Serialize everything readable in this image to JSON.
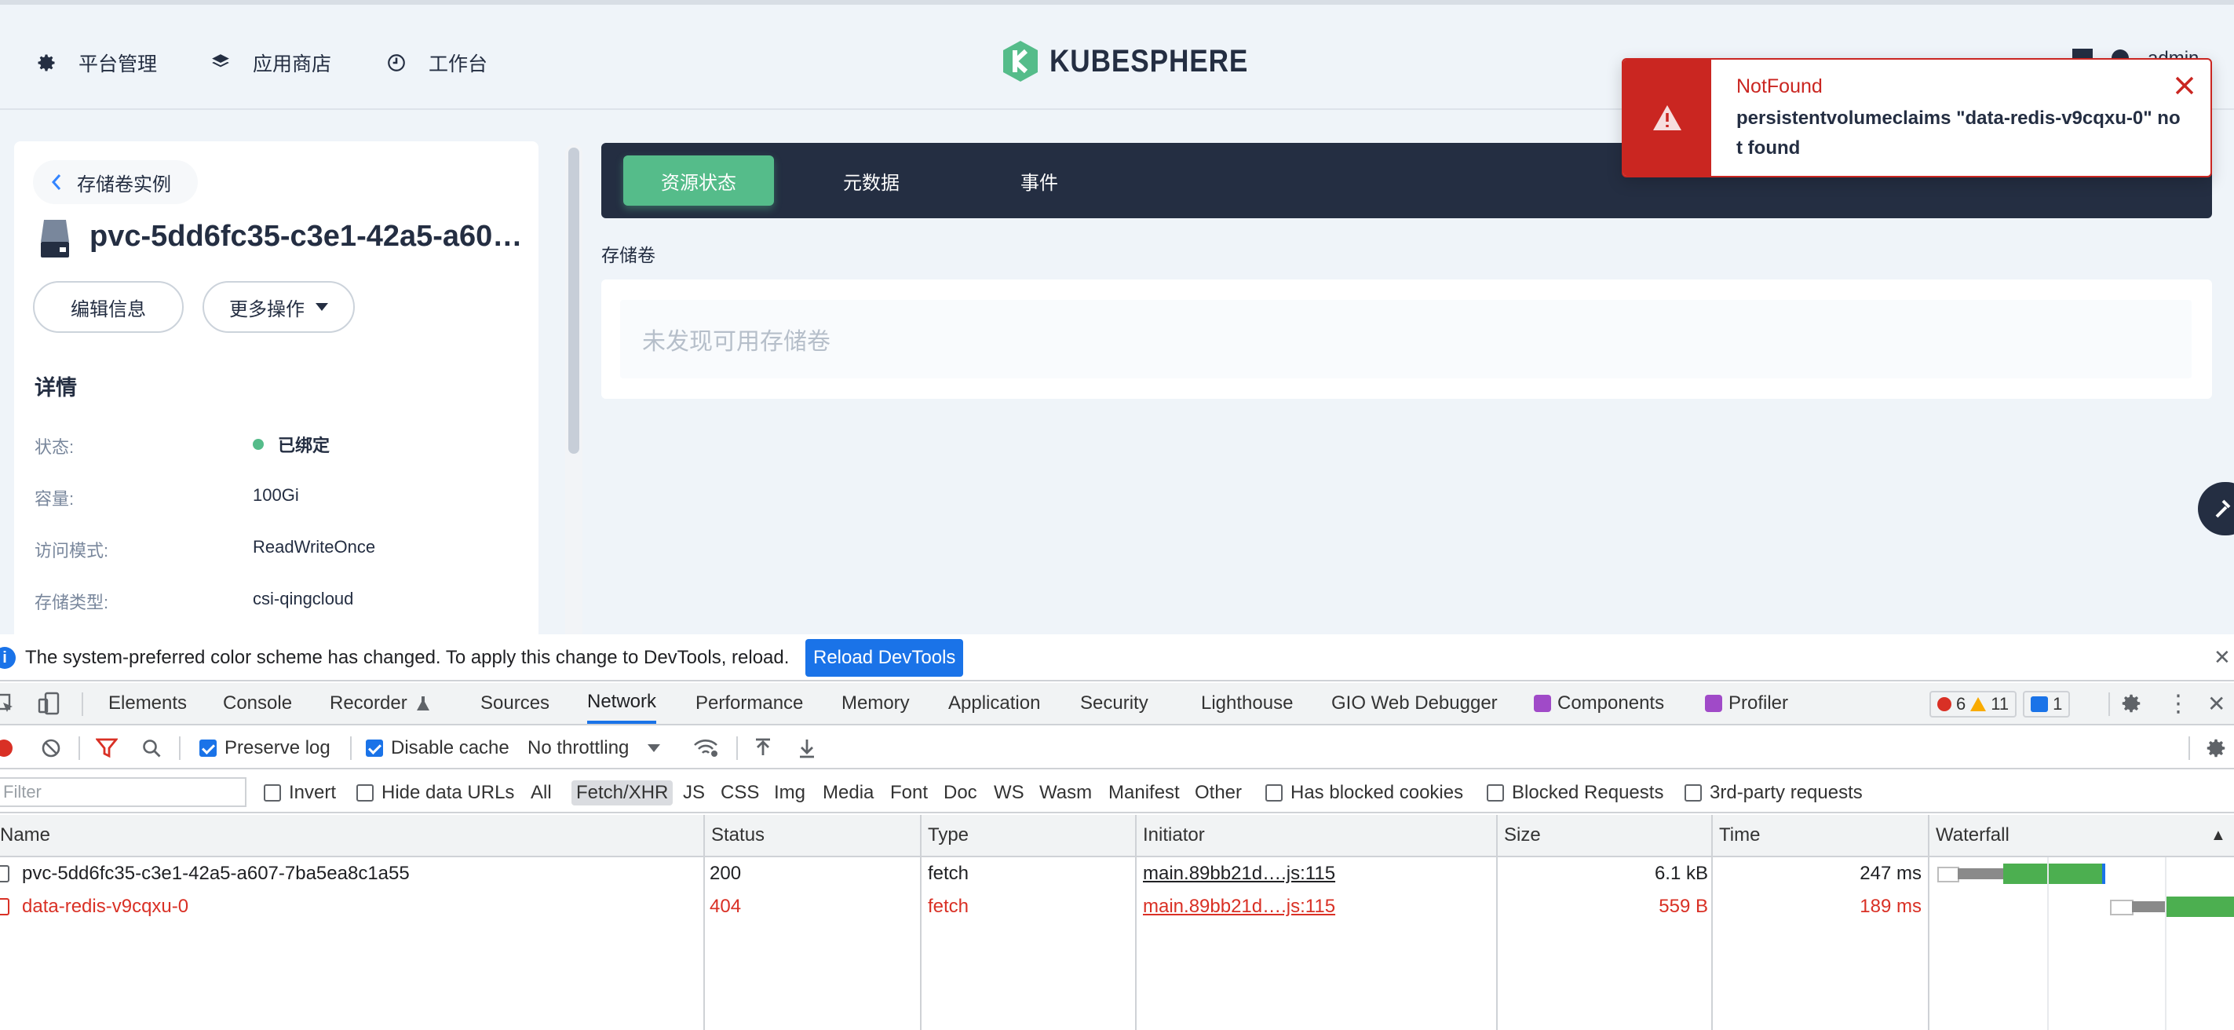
{
  "topbar": {
    "nav": [
      {
        "label": "平台管理",
        "icon": "gear-icon"
      },
      {
        "label": "应用商店",
        "icon": "layers-icon"
      },
      {
        "label": "工作台",
        "icon": "clock-icon"
      }
    ],
    "logo_text": "KUBESPHERE",
    "user_name": "admin"
  },
  "toast": {
    "title": "NotFound",
    "message": "persistentvolumeclaims \"data-redis-v9cqxu-0\" not found"
  },
  "detail": {
    "back_label": "存储卷实例",
    "title": "pvc-5dd6fc35-c3e1-42a5-a607-7ba5ea8c1a55",
    "edit_label": "编辑信息",
    "more_label": "更多操作",
    "section_title": "详情",
    "fields": [
      {
        "label": "状态:",
        "value": "已绑定"
      },
      {
        "label": "容量:",
        "value": "100Gi"
      },
      {
        "label": "访问模式:",
        "value": "ReadWriteOnce"
      },
      {
        "label": "存储类型:",
        "value": "csi-qingcloud"
      }
    ]
  },
  "main": {
    "tabs": [
      {
        "label": "资源状态"
      },
      {
        "label": "元数据"
      },
      {
        "label": "事件"
      }
    ],
    "section_label": "存储卷",
    "empty_text": "未发现可用存储卷"
  },
  "devtools": {
    "info_message": "The system-preferred color scheme has changed. To apply this change to DevTools, reload.",
    "reload_label": "Reload DevTools",
    "tabs": [
      "Elements",
      "Console",
      "Recorder",
      "Sources",
      "Network",
      "Performance",
      "Memory",
      "Application",
      "Security",
      "Lighthouse",
      "GIO Web Debugger",
      "Components",
      "Profiler"
    ],
    "active_tab": "Network",
    "counts": {
      "errors": "6",
      "warnings": "11",
      "messages": "1"
    },
    "toolbar": {
      "preserve_log": "Preserve log",
      "disable_cache": "Disable cache",
      "throttling": "No throttling"
    },
    "filter": {
      "placeholder": "Filter",
      "invert": "Invert",
      "hide_data_urls": "Hide data URLs",
      "types": [
        "All",
        "Fetch/XHR",
        "JS",
        "CSS",
        "Img",
        "Media",
        "Font",
        "Doc",
        "WS",
        "Wasm",
        "Manifest",
        "Other"
      ],
      "selected_type": "Fetch/XHR",
      "has_blocked_cookies": "Has blocked cookies",
      "blocked_requests": "Blocked Requests",
      "third_party": "3rd-party requests"
    },
    "table": {
      "columns": [
        "Name",
        "Status",
        "Type",
        "Initiator",
        "Size",
        "Time",
        "Waterfall"
      ],
      "rows": [
        {
          "name": "pvc-5dd6fc35-c3e1-42a5-a607-7ba5ea8c1a55",
          "status": "200",
          "type": "fetch",
          "initiator": "main.89bb21d….js:115",
          "size": "6.1 kB",
          "time": "247 ms",
          "error": false
        },
        {
          "name": "data-redis-v9cqxu-0",
          "status": "404",
          "type": "fetch",
          "initiator": "main.89bb21d….js:115",
          "size": "559 B",
          "time": "189 ms",
          "error": true
        }
      ]
    }
  }
}
